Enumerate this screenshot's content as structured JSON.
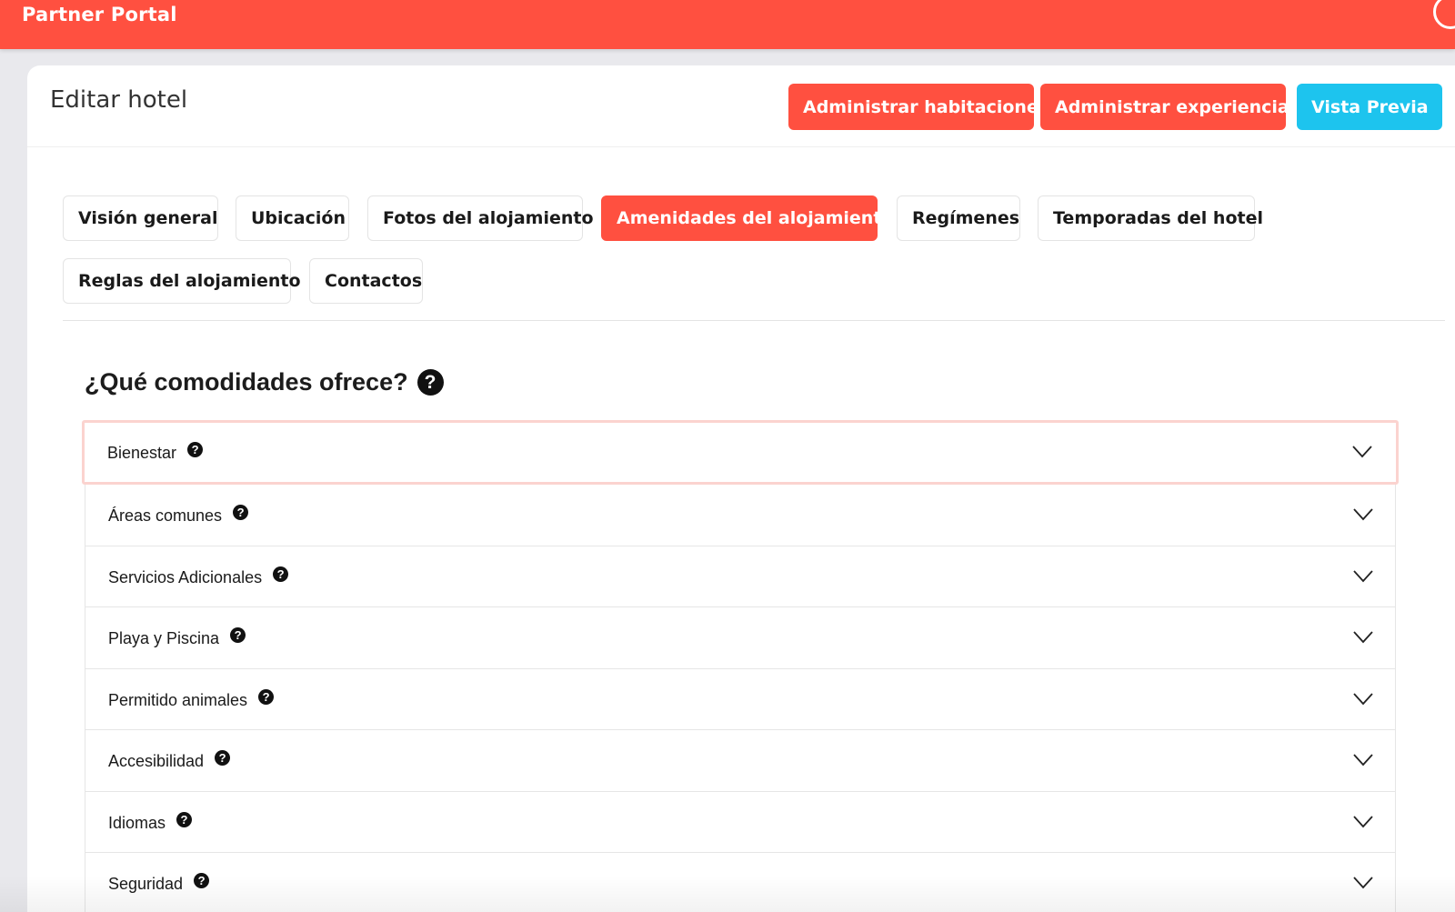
{
  "app": {
    "brand": "Partner Portal"
  },
  "header": {
    "title": "Editar hotel",
    "buttons": {
      "rooms": "Administrar habitaciones",
      "experiences": "Administrar experiencias",
      "preview": "Vista Previa"
    }
  },
  "tabs": [
    {
      "label": "Visión general"
    },
    {
      "label": "Ubicación"
    },
    {
      "label": "Fotos del alojamiento"
    },
    {
      "label": "Amenidades del alojamiento",
      "active": true
    },
    {
      "label": "Regímenes"
    },
    {
      "label": "Temporadas del hotel"
    },
    {
      "label": "Reglas del alojamiento"
    },
    {
      "label": "Contactos"
    }
  ],
  "section": {
    "title": "¿Qué comodidades ofrece?",
    "help_glyph": "?"
  },
  "amenities": [
    {
      "label": "Bienestar",
      "help_glyph": "?"
    },
    {
      "label": "Áreas comunes",
      "help_glyph": "?"
    },
    {
      "label": "Servicios Adicionales",
      "help_glyph": "?"
    },
    {
      "label": "Playa y Piscina",
      "help_glyph": "?"
    },
    {
      "label": "Permitido animales",
      "help_glyph": "?"
    },
    {
      "label": "Accesibilidad",
      "help_glyph": "?"
    },
    {
      "label": "Idiomas",
      "help_glyph": "?"
    },
    {
      "label": "Seguridad",
      "help_glyph": "?"
    }
  ],
  "colors": {
    "brand_red": "#ff5040",
    "preview_cyan": "#1dc4ee",
    "focus_ring": "#fbd3cf"
  }
}
